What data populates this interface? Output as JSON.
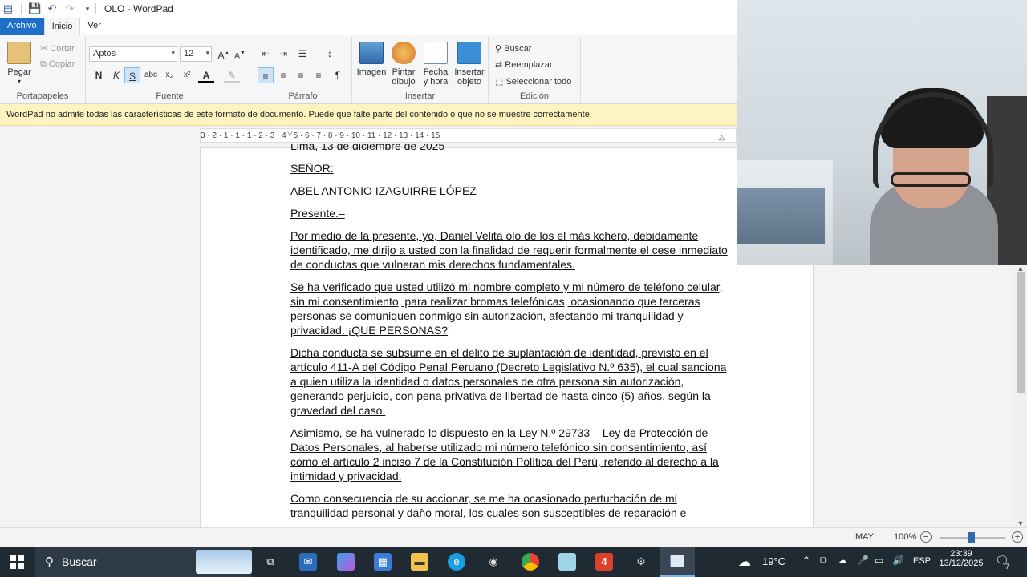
{
  "window": {
    "title": "OLO - WordPad"
  },
  "tabs": [
    {
      "label": "Archivo"
    },
    {
      "label": "Inicio"
    },
    {
      "label": "Ver"
    }
  ],
  "ribbon": {
    "clipboard": {
      "paste": "Pegar",
      "cut": "Cortar",
      "copy": "Copiar",
      "group": "Portapapeles"
    },
    "font": {
      "family": "Aptos",
      "size": "12",
      "group": "Fuente",
      "bold": "N",
      "italic": "K",
      "underline": "S",
      "strike": "abc"
    },
    "paragraph": {
      "group": "Párrafo"
    },
    "insert": {
      "image": [
        "Imagen"
      ],
      "paint": [
        "Pintar",
        "dibujo"
      ],
      "datetime": [
        "Fecha",
        "y hora"
      ],
      "object": [
        "Insertar",
        "objeto"
      ],
      "group": "Insertar"
    },
    "edit": {
      "find": "Buscar",
      "replace": "Reemplazar",
      "select_all": "Seleccionar todo",
      "group": "Edición"
    }
  },
  "infobar": {
    "text": "WordPad no admite todas las características de este formato de documento. Puede que falte parte del contenido o que no se muestre correctamente."
  },
  "ruler": {
    "marks": "3 · 2 · 1 · 1 · 1 · 2 · 3 · 4 · 5 · 6 · 7 · 8 · 9 · 10 · 11 · 12 · 13 · 14 · 15"
  },
  "document": {
    "paragraphs": [
      "Lima, 13 de diciembre de 2025",
      "SEÑOR:",
      "ABEL ANTONIO IZAGUIRRE LÓPEZ",
      "Presente.–",
      "Por medio de la presente, yo, Daniel Velita olo de los el más kchero, debidamente identificado, me dirijo a usted con la finalidad de requerir formalmente el cese inmediato de conductas que vulneran mis derechos fundamentales.",
      "Se ha verificado que usted utilizó mi nombre completo y mi número de teléfono celular, sin mi consentimiento, para realizar bromas telefónicas, ocasionando que terceras personas se comuniquen conmigo sin autorización, afectando mi tranquilidad y privacidad. ¡QUE PERSONAS?",
      "Dicha conducta se subsume en el delito de suplantación de identidad, previsto en el artículo 411-A del Código Penal Peruano (Decreto Legislativo N.º 635), el cual sanciona a quien utiliza la identidad o datos personales de otra persona sin autorización, generando perjuicio, con pena privativa de libertad de hasta cinco (5) años, según la gravedad del caso.",
      "Asimismo, se ha vulnerado lo dispuesto en la Ley N.º 29733 – Ley de Protección de Datos Personales, al haberse utilizado mi número telefónico sin consentimiento, así como el artículo 2 inciso 7 de la Constitución Política del Perú, referido al derecho a la intimidad y privacidad.",
      "Como consecuencia de su accionar, se me ha ocasionado perturbación de mi tranquilidad personal y daño moral, los cuales son susceptibles de reparación e"
    ]
  },
  "status": {
    "caps": "MAY",
    "zoom": "100%",
    "zoom_level": 1.0
  },
  "taskbar": {
    "search": "Buscar",
    "weather": "19°C",
    "lang": "ESP",
    "time": "23:39",
    "date": "13/12/2025",
    "notifications": "7"
  },
  "colors": {
    "accent": "#1e6fc8",
    "infobar": "#fdf4bf",
    "taskbar": "#1f2a33"
  }
}
